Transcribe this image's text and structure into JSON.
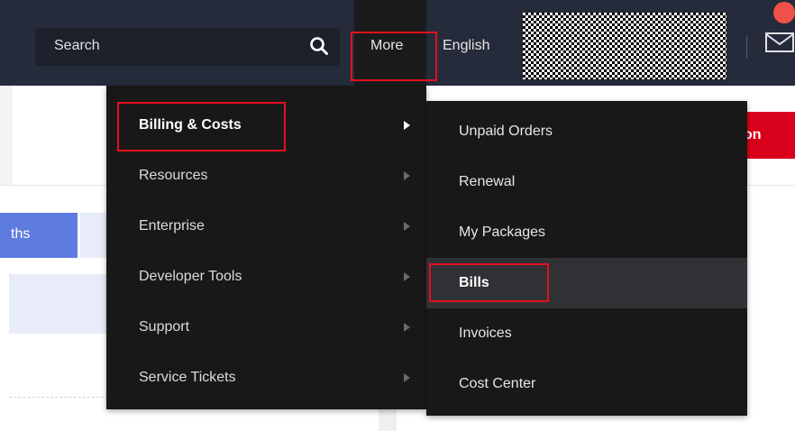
{
  "header": {
    "search_label": "Search",
    "search_icon": "magnifier",
    "more_label": "More",
    "language_label": "English",
    "mail_icon": "envelope",
    "accent_color": "#e4101f"
  },
  "background": {
    "red_button_label": "on",
    "tab_label": "ths"
  },
  "menu": {
    "items": [
      {
        "label": "Billing & Costs",
        "active": true
      },
      {
        "label": "Resources"
      },
      {
        "label": "Enterprise"
      },
      {
        "label": "Developer Tools"
      },
      {
        "label": "Support"
      },
      {
        "label": "Service Tickets"
      }
    ]
  },
  "submenu": {
    "items": [
      {
        "label": "Unpaid Orders"
      },
      {
        "label": "Renewal"
      },
      {
        "label": "My Packages"
      },
      {
        "label": "Bills",
        "selected": true
      },
      {
        "label": "Invoices"
      },
      {
        "label": "Cost Center"
      }
    ]
  }
}
